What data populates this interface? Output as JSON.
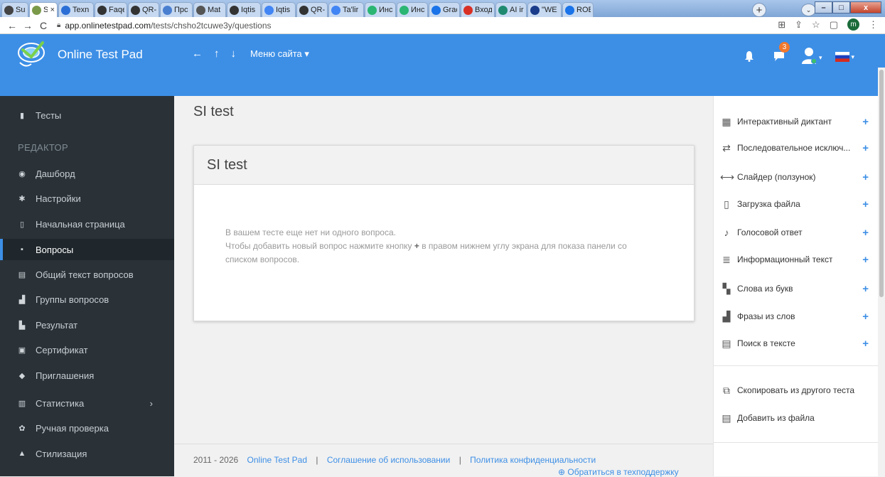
{
  "browser": {
    "tabs": [
      {
        "title": "Su'n",
        "color": "#444"
      },
      {
        "title": "S",
        "color": "#7a9a4a",
        "active": true
      },
      {
        "title": "Texn",
        "color": "#2b6fd6"
      },
      {
        "title": "Faqe",
        "color": "#333"
      },
      {
        "title": "QR-",
        "color": "#333"
      },
      {
        "title": "Прс",
        "color": "#4a7fd0"
      },
      {
        "title": "Mat",
        "color": "#555"
      },
      {
        "title": "Iqtis",
        "color": "#333"
      },
      {
        "title": "Iqtis",
        "color": "#4285f4"
      },
      {
        "title": "QR-",
        "color": "#333"
      },
      {
        "title": "Ta'lir",
        "color": "#4285f4"
      },
      {
        "title": "Инс",
        "color": "#2bb673"
      },
      {
        "title": "Инс",
        "color": "#2bb673"
      },
      {
        "title": "Grac",
        "color": "#1a73e8"
      },
      {
        "title": "Вход",
        "color": "#d93025"
      },
      {
        "title": "AI ir",
        "color": "#1f8a70"
      },
      {
        "title": "\"WE",
        "color": "#1a3c8a"
      },
      {
        "title": "ROE",
        "color": "#1a73e8"
      }
    ],
    "new_tab": "+",
    "tab_close": "×",
    "window_controls": {
      "minimize": "–",
      "maximize": "□",
      "close": "x"
    },
    "url_host": "app.onlinetestpad.com",
    "url_path": "/tests/chsho2tcuwe3y/questions",
    "profile_initial": "m"
  },
  "header": {
    "brand": "Online Test Pad",
    "back": "←",
    "up": "↑",
    "down": "↓",
    "site_menu": "Меню сайта ▾",
    "notification_count": "3"
  },
  "sidebar": {
    "top_item": "Тесты",
    "section_heading": "РЕДАКТОР",
    "items": [
      {
        "label": "Дашборд",
        "icon": "dashboard-icon",
        "glyph": "◉"
      },
      {
        "label": "Настройки",
        "icon": "gear-icon",
        "glyph": "✱"
      },
      {
        "label": "Начальная страница",
        "icon": "file-icon",
        "glyph": "▯"
      },
      {
        "label": "Вопросы",
        "icon": "question-icon",
        "glyph": "▪",
        "active": true
      },
      {
        "label": "Общий текст вопросов",
        "icon": "document-icon",
        "glyph": "▤"
      },
      {
        "label": "Группы вопросов",
        "icon": "groups-icon",
        "glyph": "▟"
      },
      {
        "label": "Результат",
        "icon": "result-icon",
        "glyph": "▙"
      },
      {
        "label": "Сертификат",
        "icon": "certificate-icon",
        "glyph": "▣"
      },
      {
        "label": "Приглашения",
        "icon": "users-icon",
        "glyph": "◆"
      },
      {
        "label": "Статистика",
        "icon": "chart-icon",
        "glyph": "▥",
        "caret": "›"
      },
      {
        "label": "Ручная проверка",
        "icon": "check-icon",
        "glyph": "✿"
      },
      {
        "label": "Стилизация",
        "icon": "gift-icon",
        "glyph": "▲"
      }
    ]
  },
  "main": {
    "page_title": "SI test",
    "panel_title": "SI test",
    "empty_line1": "В вашем тесте еще нет ни одного вопроса.",
    "empty_line2_a": "Чтобы добавить новый вопрос нажмите кнопку",
    "empty_plus": "+",
    "empty_line2_b": "в правом нижнем углу экрана для показа панели со",
    "empty_line3": "списком вопросов."
  },
  "footer": {
    "years": "2011 - 2026",
    "brand_link": "Online Test Pad",
    "separator": "|",
    "terms_link": "Соглашение об использовании",
    "privacy_link": "Политика конфиденциальности",
    "support_link": "Обратиться в техподдержку"
  },
  "right_panel": {
    "items": [
      {
        "label": "Интерактивный диктант",
        "icon": "grid-icon",
        "glyph": "▦"
      },
      {
        "label": "Последовательное исключ...",
        "icon": "swap-icon",
        "glyph": "⇄"
      },
      {
        "label": "Слайдер (ползунок)",
        "icon": "slider-icon",
        "glyph": "⟷"
      },
      {
        "label": "Загрузка файла",
        "icon": "file-upload-icon",
        "glyph": "▯"
      },
      {
        "label": "Голосовой ответ",
        "icon": "microphone-icon",
        "glyph": "♪"
      },
      {
        "label": "Информационный текст",
        "icon": "text-align-icon",
        "glyph": "≣"
      },
      {
        "label": "Слова из букв",
        "icon": "blocks-icon",
        "glyph": "▚"
      },
      {
        "label": "Фразы из слов",
        "icon": "steps-icon",
        "glyph": "▟"
      },
      {
        "label": "Поиск в тексте",
        "icon": "text-search-icon",
        "glyph": "▤"
      }
    ],
    "plus": "+",
    "copy_from_test": "Скопировать из другого теста",
    "add_from_file": "Добавить из файла"
  },
  "colors": {
    "header": "#3d8fe6",
    "sidebar": "#2a3238",
    "link": "#3d8fe6",
    "badge": "#f0782d"
  }
}
